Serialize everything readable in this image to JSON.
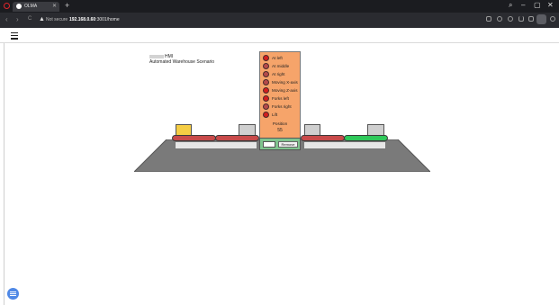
{
  "browser": {
    "tab_title": "OLMA",
    "tab_close": "✕",
    "new_tab": "+",
    "nav_back": "‹",
    "nav_forward": "›",
    "nav_reload": "C",
    "security_warning": "▲",
    "security_label": "Not secure",
    "url_host": "192.168.0.60",
    "url_path": ":3001/home",
    "window_controls": {
      "search": "⌕",
      "minimize": "–",
      "maximize": "▢",
      "close": "✕"
    }
  },
  "page": {
    "hmi_label": "HMI",
    "subtitle": "Automated Warehouse Scenario"
  },
  "status_panel": {
    "items": [
      {
        "label": "At left",
        "color": "#d21e1e"
      },
      {
        "label": "At middle",
        "color": "#b54a4a"
      },
      {
        "label": "At right",
        "color": "#b54a4a"
      },
      {
        "label": "Moving X-axis",
        "color": "#b54a4a"
      },
      {
        "label": "Moving Z-axis",
        "color": "#d21e1e"
      },
      {
        "label": "Forks left",
        "color": "#d21e1e"
      },
      {
        "label": "Forks right",
        "color": "#b54a4a"
      },
      {
        "label": "Lift",
        "color": "#d21e1e"
      }
    ],
    "position_label": "Position",
    "position_value": "55",
    "remove_input_value": "",
    "remove_button_label": "Remove"
  },
  "scene": {
    "floor_color": "#7a7a7a",
    "belt_colors": [
      "#c84a4a",
      "#c84a4a",
      "#c84a4a",
      "#2fc85a"
    ],
    "box_colors": {
      "yellow": "#f5cd44",
      "gray": "#cfcfcf"
    }
  },
  "colors": {
    "panel": "#f6a46a",
    "panel_bottom": "#7fc48e",
    "fab": "#4f88e6"
  }
}
